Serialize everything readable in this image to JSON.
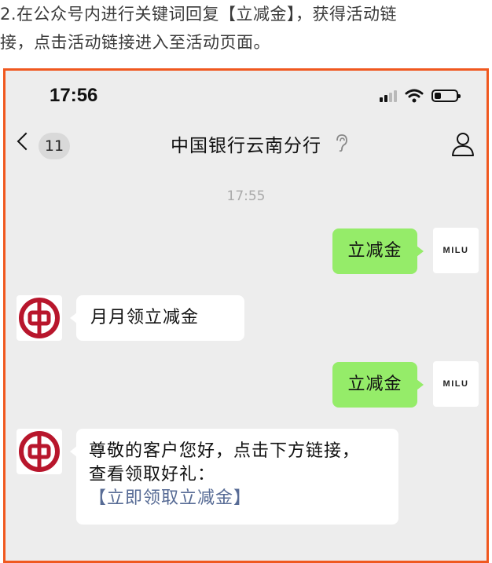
{
  "instruction": {
    "line1": "2.在公众号内进行关键词回复【立减金】，获得活动链",
    "line2": "接，点击活动链接进入至活动页面。"
  },
  "status_bar": {
    "time": "17:56"
  },
  "header": {
    "unread_count": "11",
    "title": "中国银行云南分行"
  },
  "chat": {
    "timestamp": "17:55",
    "messages": [
      {
        "from": "user",
        "text": "立减金"
      },
      {
        "from": "bank",
        "text": "月月领立减金"
      },
      {
        "from": "user",
        "text": "立减金"
      },
      {
        "from": "bank",
        "line1": "尊敬的客户您好，点击下方链接，",
        "line2": "查看领取好礼：",
        "link": "【立即领取立减金】"
      }
    ],
    "user_avatar_label": "MILU"
  },
  "colors": {
    "frame_border": "#f0581f",
    "sent_bubble": "#95ec69",
    "chat_bg": "#ededed",
    "link": "#576b95",
    "bank_red": "#b8162c"
  }
}
